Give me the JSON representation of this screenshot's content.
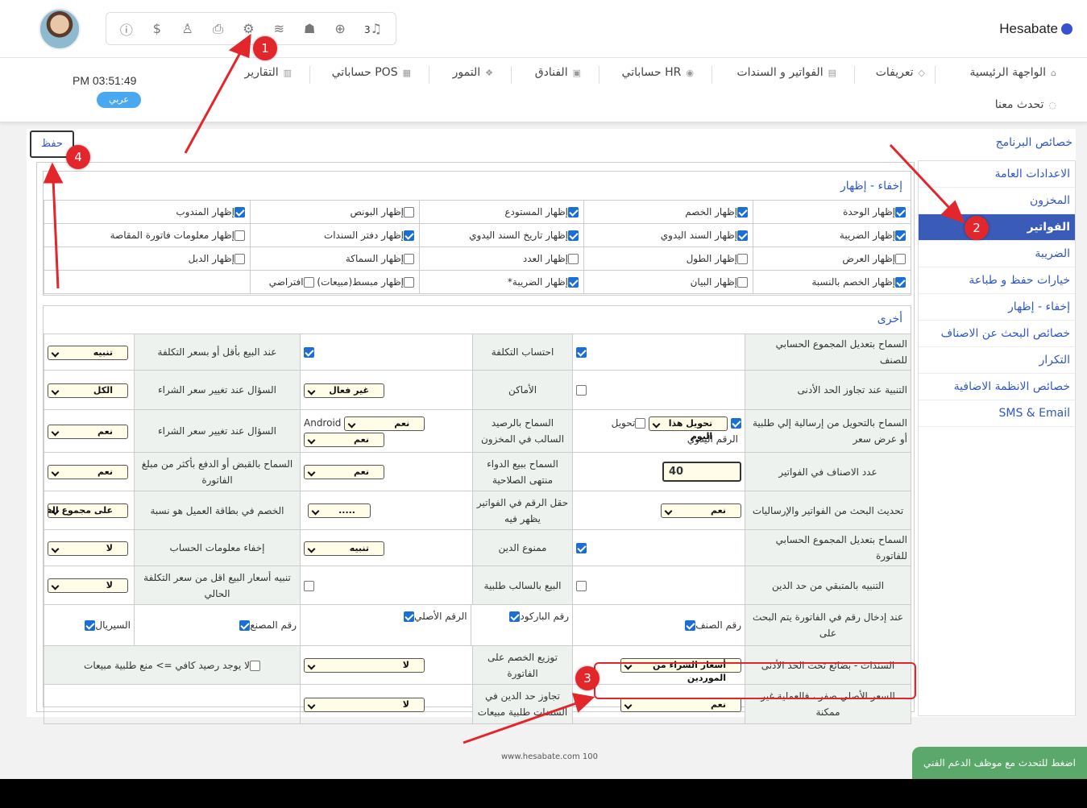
{
  "header": {
    "logo": "Hesabate",
    "clock": "PM 03:51:49",
    "language": "عربي",
    "icon_bar": [
      "info-icon",
      "money-bag-icon",
      "users-icon",
      "printer-icon",
      "settings-icon",
      "database-icon",
      "android-icon",
      "plus-circle-icon",
      "bell-icon"
    ],
    "notif_count": "3",
    "nav": [
      {
        "label": "الواجهة الرئيسية",
        "icon": "home-icon"
      },
      {
        "label": "تعريفات",
        "icon": "definitions-icon"
      },
      {
        "label": "الفواتير و السندات",
        "icon": "invoices-icon"
      },
      {
        "label": "حساباتي HR",
        "icon": "hr-icon"
      },
      {
        "label": "الفنادق",
        "icon": "hotel-icon"
      },
      {
        "label": "التمور",
        "icon": "dates-icon"
      },
      {
        "label": "حساباتي POS",
        "icon": "pos-icon"
      },
      {
        "label": "التقارير",
        "icon": "reports-icon"
      },
      {
        "label": "تحدث معنا",
        "icon": "chat-icon"
      }
    ]
  },
  "page": {
    "title": "خصائص البرنامج",
    "save": "حفظ"
  },
  "sidebar": [
    {
      "label": "الاعدادات العامة",
      "active": false
    },
    {
      "label": "المخزون",
      "active": false
    },
    {
      "label": "الفواتير",
      "active": true
    },
    {
      "label": "الضريبة",
      "active": false
    },
    {
      "label": "خيارات حفظ و طباعة",
      "active": false
    },
    {
      "label": "إخفاء - إظهار",
      "active": false
    },
    {
      "label": "خصائص البحث عن الاصناف",
      "active": false
    },
    {
      "label": "التكرار",
      "active": false
    },
    {
      "label": "خصائص الانظمة الاضافية",
      "active": false
    },
    {
      "label": "SMS & Email",
      "active": false
    }
  ],
  "hide_show": {
    "title": "إخفاء - إظهار",
    "rows": [
      [
        {
          "label": "إظهار الوحدة",
          "checked": true
        },
        {
          "label": "إظهار الخصم",
          "checked": true
        },
        {
          "label": "إظهار المستودع",
          "checked": true
        },
        {
          "label": "إظهار البونص",
          "checked": false
        },
        {
          "label": "إظهار المندوب",
          "checked": true
        }
      ],
      [
        {
          "label": "إظهار الضريبة",
          "checked": true
        },
        {
          "label": "إظهار السند اليدوي",
          "checked": true
        },
        {
          "label": "إظهار تاريخ السند اليدوي",
          "checked": true
        },
        {
          "label": "إظهار دفتر السندات",
          "checked": true
        },
        {
          "label": "إظهار معلومات فاتورة المقاصة",
          "checked": false
        }
      ],
      [
        {
          "label": "إظهار العرض",
          "checked": false
        },
        {
          "label": "إظهار الطول",
          "checked": false
        },
        {
          "label": "إظهار العدد",
          "checked": false
        },
        {
          "label": "إظهار السماكة",
          "checked": false
        },
        {
          "label": "إظهار الدبل",
          "checked": false
        }
      ],
      [
        {
          "label": "إظهار الخصم بالنسبة",
          "checked": true
        },
        {
          "label": "إظهار البيان",
          "checked": false
        },
        {
          "label": "إظهار الضريبة*",
          "checked": true
        },
        {
          "label": "إظهار مبسط(مبيعات)",
          "checked": false,
          "extra_label": "افتراضي",
          "extra_checked": false
        },
        {
          "label": "",
          "checked": null
        }
      ]
    ]
  },
  "other": {
    "title": "أخرى",
    "r1": {
      "l1": "السماح بتعديل المجموع الحسابي للصنف",
      "l2": "احتساب التكلفة",
      "l3": "عند البيع بأقل أو بسعر التكلفة",
      "v3": "تنبيه"
    },
    "r2": {
      "l1": "التنبية عند تجاوز الحد الأدنى",
      "l2": "الأماكن",
      "v2": "غير فعال",
      "l3": "السؤال عند تغيير سعر الشراء",
      "v3": "الكل"
    },
    "r3": {
      "l1": "السماح بالتحويل من إرسالية إلي طلبية أو عرض سعر",
      "v1": "تحويل هذا اليوم",
      "v1b": "تحويل",
      "sub1": "الرقم اليدوي",
      "l2": "السماح بالرصيد السالب في المخزون",
      "v2a": "نعم",
      "v2a_label": "Android",
      "v2b": "نعم",
      "l3": "السؤال عند تغيير سعر الشراء",
      "v3": "نعم"
    },
    "r4": {
      "l1": "عدد الاصناف في الفواتير",
      "v1": "40",
      "l2": "السماح ببيع الدواء منتهى الصلاحية",
      "v2": "نعم",
      "l3": "السماح بالقبض أو الدفع بأكثر من مبلغ الفاتورة",
      "v3": "نعم"
    },
    "r5": {
      "l1": "تحديث البحث من الفواتير والإرساليات",
      "v1": "نعم",
      "l2": "حقل الرقم في الفواتير يظهر فيه",
      "v2": ".....",
      "l3": "الخصم في بطاقة العميل هو نسبة",
      "v3": "على مجموع الفاتورة"
    },
    "r6": {
      "l1": "السماح بتعديل المجموع الحسابي للفاتورة",
      "l2": "ممنوع الدين",
      "v2": "تنبيه",
      "l3": "إخفاء معلومات الحساب",
      "v3": "لا"
    },
    "r7": {
      "l1": "التنبيه بالمتبقي من حد الدين",
      "l2": "البيع بالسالب طلبية",
      "l3": "تنبيه أسعار البيع اقل من سعر التكلفة الحالي",
      "v3": "لا"
    },
    "r8": {
      "l1": "عند إدخال رقم في الفاتورة يتم البحث على",
      "opts": [
        "رقم الصنف",
        "رقم الباركود",
        "الرقم الأصلي",
        "رقم المصنع",
        "السيريال"
      ]
    },
    "r9": {
      "l1": "السندات - بضائع تحت الحد الأدنى",
      "v1": "أسعار الشراء من الموردين",
      "l2": "توزيع الخصم على الفاتورة",
      "v2": "لا",
      "l3": "لا يوجد رصيد كافي => منع طلبية مبيعات"
    },
    "r10": {
      "l1": "السعر الأصلي صفر ، فالعملية غير ممكنة",
      "v1": "نعم",
      "l2": "تجاوز حد الدين في السندات طلبية مبيعات",
      "v2": "لا"
    }
  },
  "footer": {
    "text": "www.hesabate.com 100",
    "chat": "اضغط للتحدث مع موظف الدعم الفني"
  },
  "annotations": [
    "1",
    "2",
    "3",
    "4"
  ],
  "colors": {
    "accent": "#2f57c8",
    "active": "#3b5bb8",
    "marker": "#e3262c",
    "chat": "#5aa86a"
  }
}
